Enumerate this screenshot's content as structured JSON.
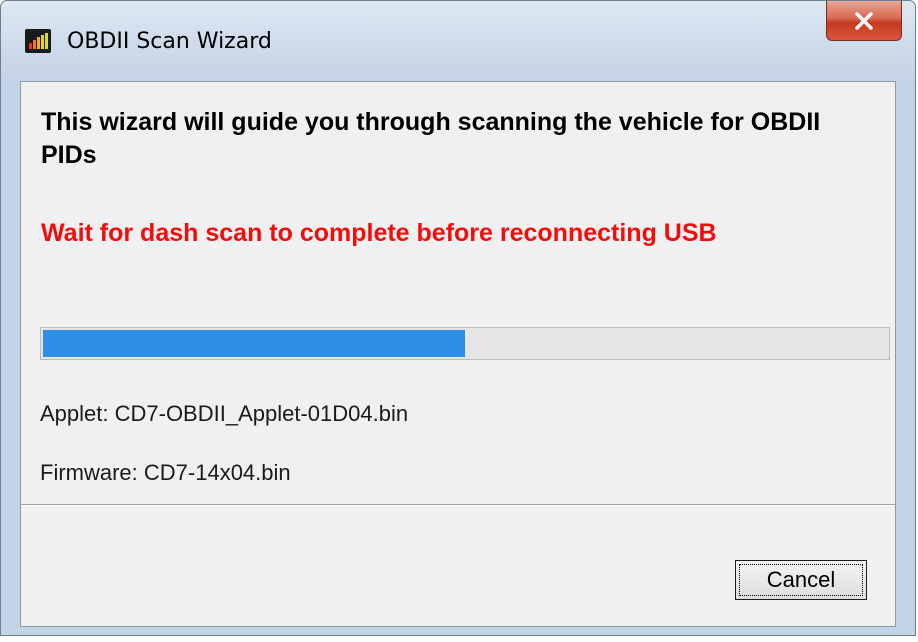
{
  "window": {
    "title": "OBDII Scan Wizard",
    "icon": "bar-graph-icon",
    "close_icon": "close-icon"
  },
  "content": {
    "heading": "This wizard will guide you through scanning the vehicle for OBDII PIDs",
    "warning": "Wait for dash scan to complete before reconnecting USB",
    "warning_color": "#f20d0d",
    "progress": {
      "percent": 50,
      "color": "#2e8fe8"
    },
    "applet": "Applet: CD7-OBDII_Applet-01D04.bin",
    "firmware": "Firmware: CD7-14x04.bin"
  },
  "buttons": {
    "cancel_label": "Cancel"
  }
}
